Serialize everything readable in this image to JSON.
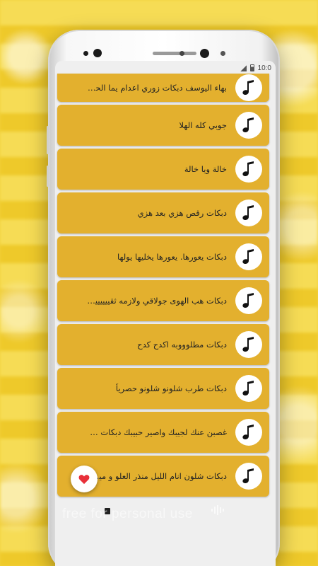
{
  "status_bar": {
    "time": "10:0",
    "icons": [
      "signal-icon",
      "battery-icon"
    ]
  },
  "songs": [
    {
      "title": "بهاء اليوسف دبكات زوري اعدام يما الحب يما",
      "icon": "music-note-icon"
    },
    {
      "title": "جوبي كله الهلا",
      "icon": "music-note-icon"
    },
    {
      "title": "خالة ويا خالة",
      "icon": "music-note-icon"
    },
    {
      "title": "دبكات رقص هزي بعد هزي",
      "icon": "music-note-icon"
    },
    {
      "title": "دبكات يعورها. يعورها يخليها يولها",
      "icon": "music-note-icon"
    },
    {
      "title": "دبكات هب الهوى جولاقي ولازمه ثقيييييييل من...",
      "icon": "music-note-icon"
    },
    {
      "title": "دبكات مطلوووبه اكدح كدح",
      "icon": "music-note-icon"
    },
    {
      "title": "دبكات طرب شلونو شلونو حصرياً",
      "icon": "music-note-icon"
    },
    {
      "title": "غصبن عنك لجيبك واصير حبيبك دبكات سوريه",
      "icon": "music-note-icon"
    },
    {
      "title": "دبكات شلون انام الليل منذر العلو و ميسر العلو",
      "icon": "music-note-icon"
    }
  ],
  "fab": {
    "icon": "heart-icon"
  },
  "watermark": "free for personal use",
  "colors": {
    "card": "#e3b02e",
    "background": "#f2d23a",
    "heart": "#e8303a"
  }
}
